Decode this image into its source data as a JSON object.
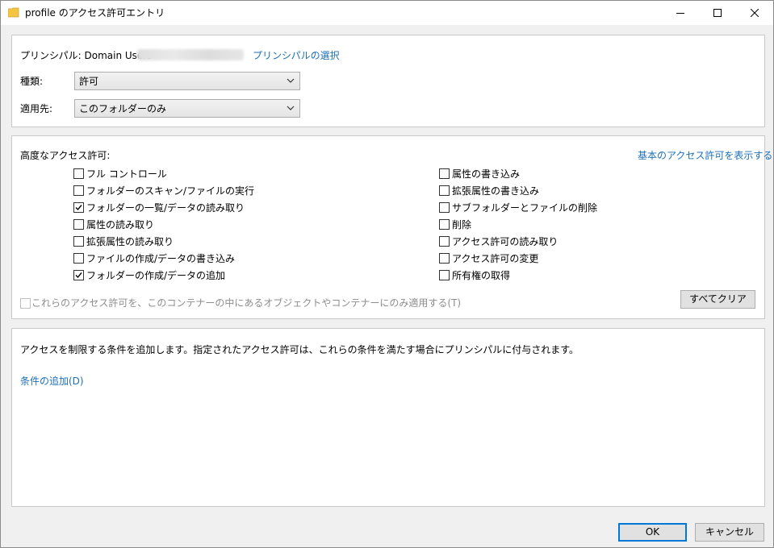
{
  "window": {
    "title": "profile のアクセス許可エントリ",
    "controls": {
      "minimize": "minimize-icon",
      "maximize": "maximize-icon",
      "close": "close-icon"
    }
  },
  "principal": {
    "label": "プリンシパル: Domain Users",
    "select_link": "プリンシパルの選択"
  },
  "type": {
    "label": "種類:",
    "value": "許可"
  },
  "applies_to": {
    "label": "適用先:",
    "value": "このフォルダーのみ"
  },
  "advanced": {
    "heading": "高度なアクセス許可:",
    "show_basic_link": "基本のアクセス許可を表示する",
    "left": [
      {
        "label": "フル コントロール",
        "checked": false
      },
      {
        "label": "フォルダーのスキャン/ファイルの実行",
        "checked": false
      },
      {
        "label": "フォルダーの一覧/データの読み取り",
        "checked": true
      },
      {
        "label": "属性の読み取り",
        "checked": false
      },
      {
        "label": "拡張属性の読み取り",
        "checked": false
      },
      {
        "label": "ファイルの作成/データの書き込み",
        "checked": false
      },
      {
        "label": "フォルダーの作成/データの追加",
        "checked": true
      }
    ],
    "right": [
      {
        "label": "属性の書き込み",
        "checked": false
      },
      {
        "label": "拡張属性の書き込み",
        "checked": false
      },
      {
        "label": "サブフォルダーとファイルの削除",
        "checked": false
      },
      {
        "label": "削除",
        "checked": false
      },
      {
        "label": "アクセス許可の読み取り",
        "checked": false
      },
      {
        "label": "アクセス許可の変更",
        "checked": false
      },
      {
        "label": "所有権の取得",
        "checked": false
      }
    ],
    "apply_only_label": "これらのアクセス許可を、このコンテナーの中にあるオブジェクトやコンテナーにのみ適用する(T)",
    "clear_all": "すべてクリア"
  },
  "conditions": {
    "description": "アクセスを制限する条件を追加します。指定されたアクセス許可は、これらの条件を満たす場合にプリンシパルに付与されます。",
    "add_link": "条件の追加(D)"
  },
  "footer": {
    "ok": "OK",
    "cancel": "キャンセル"
  },
  "colors": {
    "link": "#1c6fb6",
    "default_button_border": "#0078d7",
    "folder_icon": "#f5c542"
  }
}
